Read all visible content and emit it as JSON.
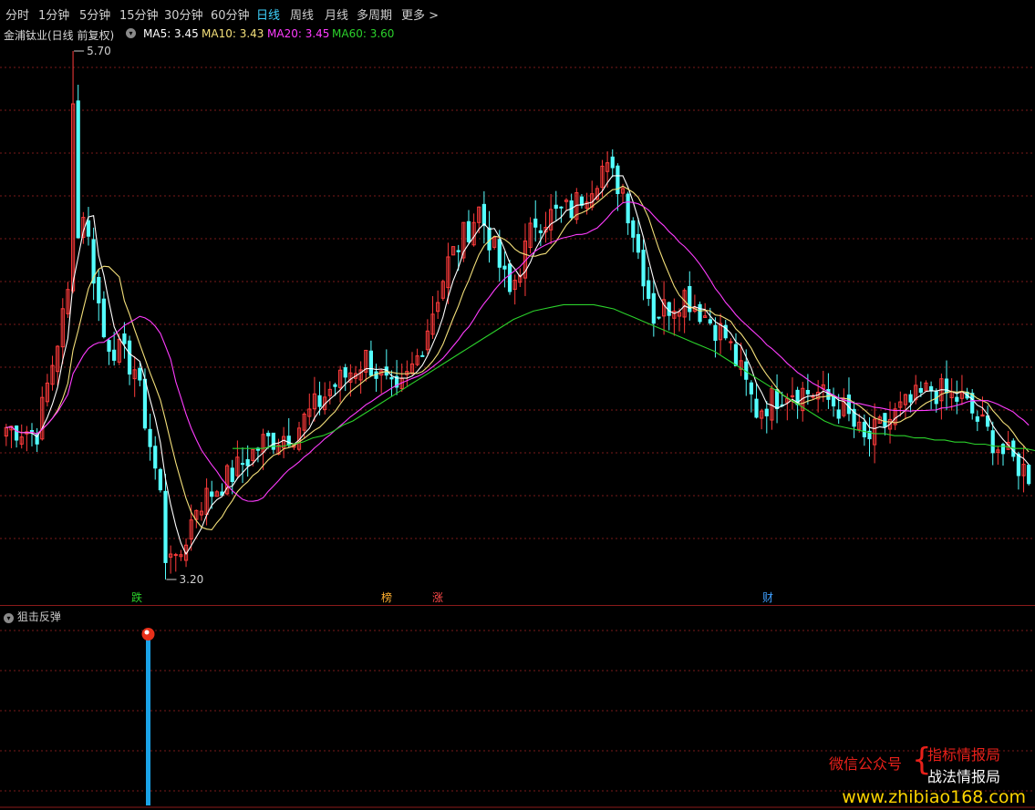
{
  "toolbar": {
    "tabs": [
      {
        "label": "分时"
      },
      {
        "label": "1分钟"
      },
      {
        "label": "5分钟"
      },
      {
        "label": "15分钟"
      },
      {
        "label": "30分钟"
      },
      {
        "label": "60分钟"
      },
      {
        "label": "日线"
      },
      {
        "label": "周线"
      },
      {
        "label": "月线"
      },
      {
        "label": "多周期"
      },
      {
        "label": "更多 >"
      }
    ],
    "active": "日线"
  },
  "stock_header": {
    "title": "金浦钛业(日线 前复权)",
    "ma5_label": "MA5: 3.45",
    "ma10_label": "MA10: 3.43",
    "ma20_label": "MA20: 3.45",
    "ma60_label": "MA60: 3.60"
  },
  "colors": {
    "up": "#ff3b3b",
    "down": "#54ffff",
    "ma5": "#ffffff",
    "ma10": "#f4e07a",
    "ma20": "#ff3cff",
    "ma60": "#2bd12b",
    "grid": "#7a1a1a",
    "indicator_bar": "#1aa3e8"
  },
  "indicator": {
    "title": "狙击反弹"
  },
  "chart_data": {
    "type": "candlestick",
    "price_range": [
      3.2,
      5.7
    ],
    "annotations": [
      {
        "text": "5.70",
        "value": 5.7,
        "kind": "high"
      },
      {
        "text": "3.20",
        "value": 3.2,
        "kind": "low"
      }
    ],
    "markers": [
      {
        "text": "跌",
        "color": "#2bd12b"
      },
      {
        "text": "榜",
        "color": "#ffb030"
      },
      {
        "text": "涨",
        "color": "#ff4a4a"
      },
      {
        "text": "财",
        "color": "#3fa0ff"
      }
    ],
    "ma60_path": [
      3.82,
      3.82,
      3.82,
      3.82,
      3.83,
      3.83,
      3.84,
      3.85,
      3.87,
      3.88,
      3.9,
      3.93,
      3.95,
      3.98,
      4.01,
      4.04,
      4.07,
      4.1,
      4.13,
      4.16,
      4.19,
      4.22,
      4.25,
      4.28,
      4.31,
      4.34,
      4.37,
      4.4,
      4.43,
      4.45,
      4.47,
      4.48,
      4.49,
      4.5,
      4.5,
      4.5,
      4.5,
      4.49,
      4.48,
      4.46,
      4.44,
      4.42,
      4.4,
      4.38,
      4.36,
      4.34,
      4.32,
      4.3,
      4.28,
      4.25,
      4.22,
      4.19,
      4.16,
      4.13,
      4.1,
      4.07,
      4.04,
      4.01,
      3.98,
      3.95,
      3.93,
      3.92,
      3.91,
      3.9,
      3.89,
      3.89,
      3.88,
      3.88,
      3.87,
      3.87,
      3.86,
      3.86,
      3.85,
      3.85,
      3.84,
      3.84,
      3.83,
      3.83,
      3.82,
      3.82,
      3.81
    ],
    "series_labels": [
      "MA5",
      "MA10",
      "MA20",
      "MA60"
    ]
  }
}
